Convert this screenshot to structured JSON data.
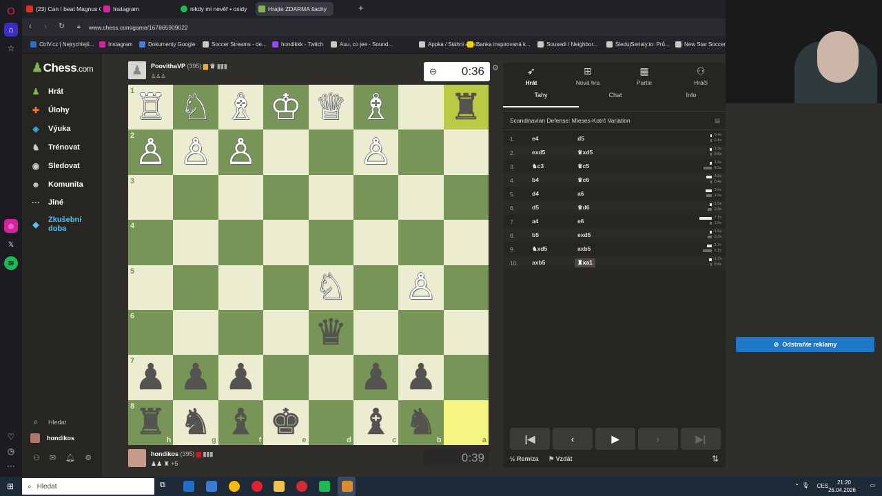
{
  "browser": {
    "tabs": [
      {
        "label": "(23) Can I beat Magnus C...",
        "icon": "youtube-icon",
        "color": "#e52d27",
        "active": false
      },
      {
        "label": "Instagram",
        "icon": "instagram-icon",
        "color": "#d6249f",
        "active": false
      },
      {
        "label": "nikdy mi nevěř • oxidy",
        "icon": "spotify-icon",
        "color": "#1db954",
        "active": false
      },
      {
        "label": "Hrajte ZDARMA šachy",
        "icon": "chess-icon",
        "color": "#81b64c",
        "active": true
      }
    ],
    "url": "www.chess.com/game/167865909022",
    "bookmarks": [
      {
        "label": "CtrlV.cz | Nejrychlejš...",
        "color": "#2c6fb8"
      },
      {
        "label": "Instagram",
        "color": "#d6249f"
      },
      {
        "label": "Dokumenty Google",
        "color": "#4a7bd0"
      },
      {
        "label": "Soccer Streams - de...",
        "color": "#c9c9c9"
      },
      {
        "label": "hondikkk - Twitch",
        "color": "#9146ff"
      },
      {
        "label": "Auu, co jee - Sound...",
        "color": "#c9c9c9"
      },
      {
        "label": "Appka / Stáhni a ze...",
        "color": "#c9c9c9"
      },
      {
        "label": "Banka inspirovaná k...",
        "color": "#f2d400"
      },
      {
        "label": "Sousedi / Neighbor...",
        "color": "#c9c9c9"
      },
      {
        "label": "SledujSerialy.to: Prů...",
        "color": "#c9c9c9"
      },
      {
        "label": "New Star Soccer",
        "color": "#c9c9c9"
      }
    ]
  },
  "site": {
    "logo": "Chess",
    "logo_suffix": ".com",
    "nav": [
      {
        "label": "Hrát",
        "icon": "play-icon",
        "color": "#81b64c"
      },
      {
        "label": "Úlohy",
        "icon": "puzzle-icon",
        "color": "#e87a2d"
      },
      {
        "label": "Výuka",
        "icon": "learn-icon",
        "color": "#3aa3d8"
      },
      {
        "label": "Trénovat",
        "icon": "train-icon",
        "color": "#cccccc"
      },
      {
        "label": "Sledovat",
        "icon": "watch-icon",
        "color": "#cccccc"
      },
      {
        "label": "Komunita",
        "icon": "community-icon",
        "color": "#cccccc"
      },
      {
        "label": "Jiné",
        "icon": "more-icon",
        "color": "#cccccc"
      },
      {
        "label": "Zkušební doba",
        "icon": "diamond-icon",
        "color": "#4fc3f7"
      }
    ],
    "search_label": "Hledat",
    "user_label": "hondikos"
  },
  "game": {
    "opponent": {
      "name": "PoovithaVP",
      "rating": "(395)",
      "clock": "0:36"
    },
    "player": {
      "name": "hondikos",
      "rating": "(395)",
      "clock": "0:39",
      "captured_extra": "+5"
    },
    "board": [
      [
        "♖",
        "♘",
        "♗",
        "♔",
        "♕",
        "♗",
        "",
        "♜"
      ],
      [
        "♙",
        "♙",
        "♙",
        "",
        "",
        "♙",
        "",
        ""
      ],
      [
        "",
        "",
        "",
        "",
        "",
        "",
        "",
        ""
      ],
      [
        "",
        "",
        "",
        "",
        "",
        "",
        "",
        ""
      ],
      [
        "",
        "",
        "",
        "",
        "♘",
        "",
        "♙",
        ""
      ],
      [
        "",
        "",
        "",
        "",
        "♛",
        "",
        "",
        ""
      ],
      [
        "♟",
        "♟",
        "♟",
        "",
        "",
        "♟",
        "♟",
        ""
      ],
      [
        "♜",
        "♞",
        "♝",
        "♚",
        "",
        "♝",
        "♞",
        ""
      ]
    ],
    "white_pieces": [
      [
        0,
        0
      ],
      [
        0,
        1
      ],
      [
        0,
        2
      ],
      [
        0,
        3
      ],
      [
        0,
        4
      ],
      [
        0,
        5
      ],
      [
        1,
        0
      ],
      [
        1,
        1
      ],
      [
        1,
        2
      ],
      [
        1,
        5
      ],
      [
        4,
        4
      ],
      [
        4,
        6
      ]
    ],
    "highlight": [
      [
        0,
        7
      ],
      [
        7,
        7
      ]
    ],
    "ranks": [
      "1",
      "2",
      "3",
      "4",
      "5",
      "6",
      "7",
      "8"
    ],
    "files": [
      "h",
      "g",
      "f",
      "e",
      "d",
      "c",
      "b",
      "a"
    ]
  },
  "panel": {
    "top_buttons": [
      "Hrát",
      "Nová hra",
      "Partie",
      "Hráči"
    ],
    "sub_tabs": [
      "Tahy",
      "Chat",
      "Info"
    ],
    "opening": "Scandinavian Defense: Mieses-Kotrč Variation",
    "moves": [
      {
        "n": "1.",
        "w": "e4",
        "b": "d5",
        "wt": "0.4s",
        "bt": "0.1s"
      },
      {
        "n": "2.",
        "w": "exd5",
        "b": "♛xd5",
        "wt": "1.3s",
        "bt": "0.6s"
      },
      {
        "n": "3.",
        "w": "♞c3",
        "b": "♛c5",
        "wt": "1.0s",
        "bt": "4.5s"
      },
      {
        "n": "4.",
        "w": "b4",
        "b": "♛c6",
        "wt": "3.2s",
        "bt": "0.4s"
      },
      {
        "n": "5.",
        "w": "d4",
        "b": "a6",
        "wt": "3.6s",
        "bt": "3.0s"
      },
      {
        "n": "6.",
        "w": "d5",
        "b": "♛d6",
        "wt": "1.0s",
        "bt": "2.3s"
      },
      {
        "n": "7.",
        "w": "a4",
        "b": "e6",
        "wt": "7.1s",
        "bt": "1.0s"
      },
      {
        "n": "8.",
        "w": "b5",
        "b": "exd5",
        "wt": "1.1s",
        "bt": "2.2s"
      },
      {
        "n": "9.",
        "w": "♞xd5",
        "b": "axb5",
        "wt": "2.7s",
        "bt": "5.1s"
      },
      {
        "n": "10.",
        "w": "axb5",
        "b": "♜xa1",
        "wt": "1.7s",
        "bt": "0.4s"
      }
    ],
    "draw_label": "Remíza",
    "resign_label": "Vzdát"
  },
  "ad": {
    "remove_label": "Odstraňte reklamy"
  },
  "taskbar": {
    "search_placeholder": "Hledat",
    "lang": "CES",
    "time": "21:20",
    "date": "26.04.2026"
  }
}
